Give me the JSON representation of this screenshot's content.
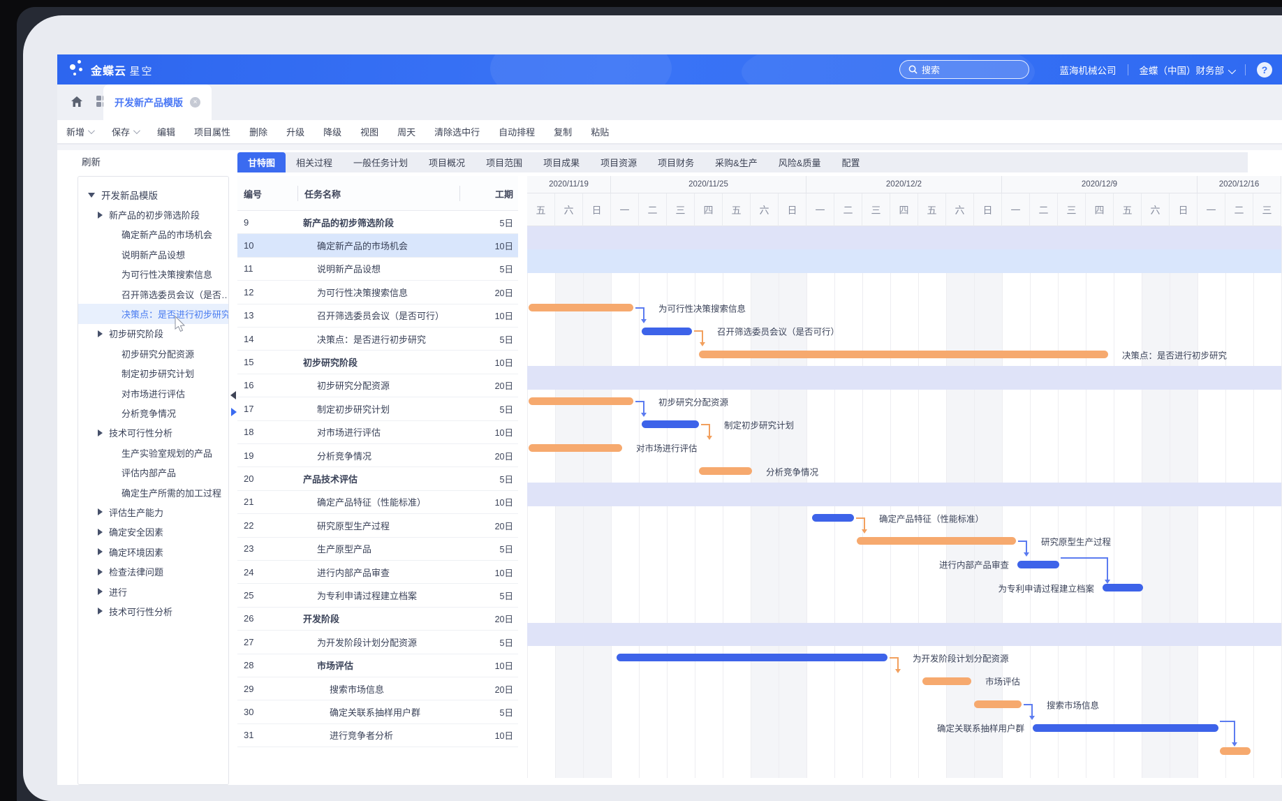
{
  "appbar": {
    "logo_primary": "金蝶云",
    "logo_secondary": "星空",
    "search_placeholder": "搜索",
    "company": "蓝海机械公司",
    "user": "金蝶（中国）财务部",
    "help_label": "?"
  },
  "tabbar": {
    "active_tab": "开发新产品模版"
  },
  "toolbar": {
    "items": [
      {
        "label": "新增",
        "dropdown": true
      },
      {
        "label": "保存",
        "dropdown": true
      },
      {
        "label": "编辑"
      },
      {
        "label": "项目属性"
      },
      {
        "label": "删除"
      },
      {
        "label": "升级"
      },
      {
        "label": "降级"
      },
      {
        "label": "视图"
      },
      {
        "label": "周天"
      },
      {
        "label": "清除选中行"
      },
      {
        "label": "自动排程"
      },
      {
        "label": "复制"
      },
      {
        "label": "粘贴"
      }
    ]
  },
  "sidebar": {
    "refresh_label": "刷新",
    "tree": [
      {
        "label": "开发新品模版",
        "level": 0,
        "arrow": "down"
      },
      {
        "label": "新产品的初步筛选阶段",
        "level": 1,
        "arrow": "right"
      },
      {
        "label": "确定新产品的市场机会",
        "level": 2
      },
      {
        "label": "说明新产品设想",
        "level": 2
      },
      {
        "label": "为可行性决策搜索信息",
        "level": 2
      },
      {
        "label": "召开筛选委员会议（是否…",
        "level": 2
      },
      {
        "label": "决策点：是否进行初步研究",
        "level": 2,
        "selected": true
      },
      {
        "label": "初步研究阶段",
        "level": 1,
        "arrow": "right"
      },
      {
        "label": "初步研究分配资源",
        "level": 2
      },
      {
        "label": "制定初步研究计划",
        "level": 2
      },
      {
        "label": "对市场进行评估",
        "level": 2
      },
      {
        "label": "分析竞争情况",
        "level": 2
      },
      {
        "label": "技术可行性分析",
        "level": 1,
        "arrow": "right"
      },
      {
        "label": "生产实验室规划的产品",
        "level": 2
      },
      {
        "label": "评估内部产品",
        "level": 2
      },
      {
        "label": "确定生产所需的加工过程",
        "level": 2
      },
      {
        "label": "评估生产能力",
        "level": 1,
        "arrow": "right"
      },
      {
        "label": "确定安全因素",
        "level": 1,
        "arrow": "right"
      },
      {
        "label": "确定环境因素",
        "level": 1,
        "arrow": "right"
      },
      {
        "label": "检查法律问题",
        "level": 1,
        "arrow": "right"
      },
      {
        "label": "进行",
        "level": 1,
        "arrow": "right"
      },
      {
        "label": "技术可行性分析",
        "level": 1,
        "arrow": "right"
      }
    ]
  },
  "view_tabs": [
    "甘特图",
    "相关过程",
    "一般任务计划",
    "项目概况",
    "项目范围",
    "项目成果",
    "项目资源",
    "项目财务",
    "采购&生产",
    "风险&质量",
    "配置"
  ],
  "active_view_tab": "甘特图",
  "task_table": {
    "columns": [
      "编号",
      "任务名称",
      "工期"
    ],
    "rows": [
      {
        "id": 9,
        "name": "新产品的初步筛选阶段",
        "duration": "5日",
        "type": "phase"
      },
      {
        "id": 10,
        "name": "确定新产品的市场机会",
        "duration": "10日",
        "type": "task",
        "selected": true
      },
      {
        "id": 11,
        "name": "说明新产品设想",
        "duration": "5日",
        "type": "task"
      },
      {
        "id": 12,
        "name": "为可行性决策搜索信息",
        "duration": "20日",
        "type": "task"
      },
      {
        "id": 13,
        "name": "召开筛选委员会议（是否可行）",
        "duration": "10日",
        "type": "task"
      },
      {
        "id": 14,
        "name": "决策点：是否进行初步研究",
        "duration": "5日",
        "type": "task"
      },
      {
        "id": 15,
        "name": "初步研究阶段",
        "duration": "10日",
        "type": "phase"
      },
      {
        "id": 16,
        "name": "初步研究分配资源",
        "duration": "20日",
        "type": "task"
      },
      {
        "id": 17,
        "name": "制定初步研究计划",
        "duration": "5日",
        "type": "task"
      },
      {
        "id": 18,
        "name": "对市场进行评估",
        "duration": "10日",
        "type": "task"
      },
      {
        "id": 19,
        "name": "分析竞争情况",
        "duration": "20日",
        "type": "task"
      },
      {
        "id": 20,
        "name": "产品技术评估",
        "duration": "5日",
        "type": "phase"
      },
      {
        "id": 21,
        "name": "确定产品特征（性能标准）",
        "duration": "10日",
        "type": "task"
      },
      {
        "id": 22,
        "name": "研究原型生产过程",
        "duration": "20日",
        "type": "task"
      },
      {
        "id": 23,
        "name": "生产原型产品",
        "duration": "5日",
        "type": "task"
      },
      {
        "id": 24,
        "name": "进行内部产品审查",
        "duration": "10日",
        "type": "task"
      },
      {
        "id": 25,
        "name": "为专利申请过程建立档案",
        "duration": "5日",
        "type": "task"
      },
      {
        "id": 26,
        "name": "开发阶段",
        "duration": "20日",
        "type": "phase"
      },
      {
        "id": 27,
        "name": "为开发阶段计划分配资源",
        "duration": "5日",
        "type": "task"
      },
      {
        "id": 28,
        "name": "市场评估",
        "duration": "10日",
        "type": "subphase"
      },
      {
        "id": 29,
        "name": "搜索市场信息",
        "duration": "20日",
        "type": "subtask"
      },
      {
        "id": 30,
        "name": "确定关联系抽样用户群",
        "duration": "5日",
        "type": "subtask"
      },
      {
        "id": 31,
        "name": "进行竞争者分析",
        "duration": "10日",
        "type": "subtask"
      }
    ]
  },
  "chart_data": {
    "type": "gantt",
    "date_groups": [
      {
        "label": "2020/11/19",
        "days": [
          "五",
          "六",
          "日"
        ]
      },
      {
        "label": "2020/11/25",
        "days": [
          "一",
          "二",
          "三",
          "四",
          "五",
          "六",
          "日"
        ]
      },
      {
        "label": "2020/12/2",
        "days": [
          "一",
          "二",
          "三",
          "四",
          "五",
          "六",
          "日"
        ]
      },
      {
        "label": "2020/12/9",
        "days": [
          "一",
          "二",
          "三",
          "四",
          "五",
          "六",
          "日"
        ]
      },
      {
        "label": "2020/12/16",
        "days": [
          "一",
          "二",
          "三"
        ]
      }
    ],
    "phase_band_rows": [
      9,
      15,
      20,
      26
    ],
    "selected_row": 10,
    "bars": [
      {
        "row": 12,
        "start": 0.05,
        "end": 3.8,
        "color": "orange",
        "label": "为可行性决策搜索信息",
        "label_side": "right",
        "conn": "down",
        "conn_color": "blue"
      },
      {
        "row": 13,
        "start": 4.1,
        "end": 5.9,
        "color": "blue",
        "label": "召开筛选委员会议（是否可行）",
        "label_side": "right",
        "conn": "down",
        "conn_color": "orange"
      },
      {
        "row": 14,
        "start": 6.15,
        "end": 20.8,
        "color": "orange",
        "label": "决策点：是否进行初步研究",
        "label_side": "right"
      },
      {
        "row": 16,
        "start": 0.05,
        "end": 3.8,
        "color": "orange",
        "label": "初步研究分配资源",
        "label_side": "right",
        "conn": "down",
        "conn_color": "blue"
      },
      {
        "row": 17,
        "start": 4.1,
        "end": 6.15,
        "color": "blue",
        "label": "制定初步研究计划",
        "label_side": "right",
        "conn": "down",
        "conn_color": "orange"
      },
      {
        "row": 18,
        "start": 0.05,
        "end": 3.4,
        "color": "orange",
        "label": "对市场进行评估",
        "label_side": "right"
      },
      {
        "row": 19,
        "start": 6.15,
        "end": 8.05,
        "color": "orange",
        "label": "分析竞争情况",
        "label_side": "right"
      },
      {
        "row": 21,
        "start": 10.2,
        "end": 11.7,
        "color": "blue",
        "label": "确定产品特征（性能标准）",
        "label_side": "right",
        "conn": "down",
        "conn_color": "orange"
      },
      {
        "row": 22,
        "start": 11.8,
        "end": 17.5,
        "color": "orange",
        "label": "研究原型生产过程",
        "label_side": "right",
        "conn": "down",
        "conn_color": "blue"
      },
      {
        "row": 23,
        "start": 17.55,
        "end": 19.05,
        "color": "blue",
        "label": "进行内部产品审查",
        "label_side": "left",
        "conn": "elbow",
        "conn_color": "blue",
        "conn_to": 20.6
      },
      {
        "row": 24,
        "start": 20.6,
        "end": 22.05,
        "color": "blue",
        "label": "为专利申请过程建立档案",
        "label_side": "left"
      },
      {
        "row": 27,
        "start": 3.2,
        "end": 12.9,
        "color": "blue",
        "label": "为开发阶段计划分配资源",
        "label_side": "right",
        "conn": "down",
        "conn_color": "orange"
      },
      {
        "row": 28,
        "start": 14.15,
        "end": 15.9,
        "color": "orange",
        "label": "市场评估",
        "label_side": "right"
      },
      {
        "row": 29,
        "start": 16.0,
        "end": 17.7,
        "color": "orange",
        "label": "搜索市场信息",
        "label_side": "right",
        "conn": "down",
        "conn_color": "blue"
      },
      {
        "row": 30,
        "start": 18.1,
        "end": 24.75,
        "color": "blue",
        "label": "确定关联系抽样用户群",
        "label_side": "left",
        "conn": "elbow",
        "conn_color": "blue",
        "conn_to": 25.15
      },
      {
        "row": 31,
        "start": 24.8,
        "end": 25.9,
        "color": "orange"
      }
    ],
    "colors": {
      "bar_blue": "#3d63e9",
      "bar_orange": "#f6a96e",
      "conn_blue": "#5b7bf0",
      "conn_orange": "#f2a05e",
      "phase_band": "#dfe3f8",
      "selection_band": "#d9e6fc"
    }
  }
}
